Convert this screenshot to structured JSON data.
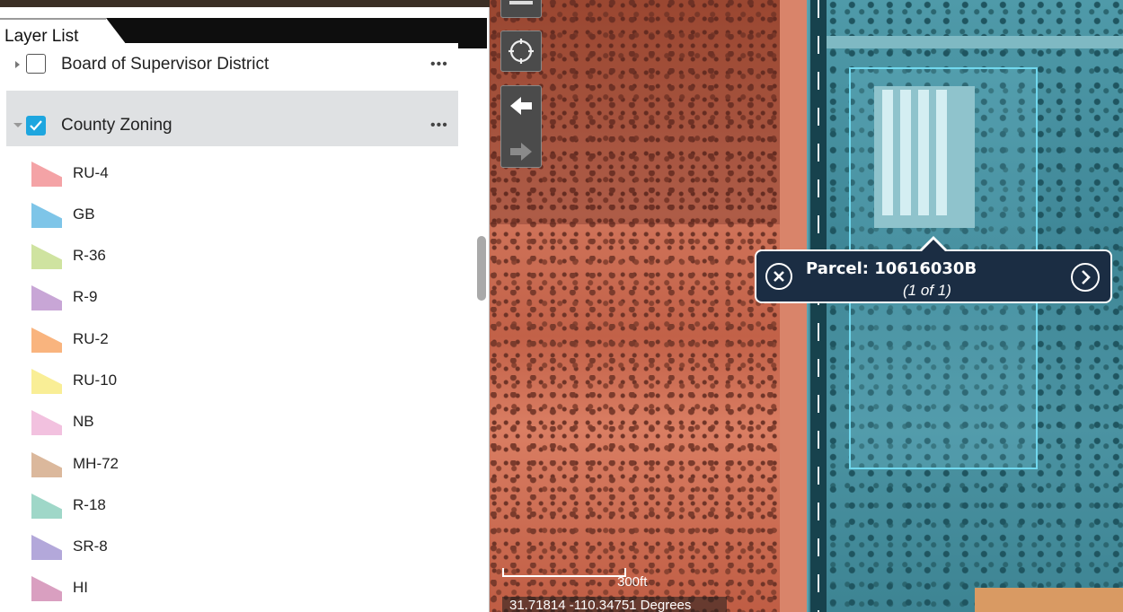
{
  "layer_list": {
    "tab_label": "Layer List",
    "layers": [
      {
        "label": "Board of Supervisor District",
        "checked": false,
        "expanded": false,
        "more": "•••"
      },
      {
        "label": "County Zoning",
        "checked": true,
        "expanded": true,
        "more": "•••"
      }
    ],
    "legend": [
      {
        "label": "RU-4",
        "color": "#f4a3a6"
      },
      {
        "label": "GB",
        "color": "#7ec5e8"
      },
      {
        "label": "R-36",
        "color": "#cfe3a0"
      },
      {
        "label": "R-9",
        "color": "#c8a6d6"
      },
      {
        "label": "RU-2",
        "color": "#f9b47e"
      },
      {
        "label": "RU-10",
        "color": "#f9ee96"
      },
      {
        "label": "NB",
        "color": "#f2c1df"
      },
      {
        "label": "MH-72",
        "color": "#dbb89c"
      },
      {
        "label": "R-18",
        "color": "#9fd7c8"
      },
      {
        "label": "SR-8",
        "color": "#b3a8da"
      },
      {
        "label": "HI",
        "color": "#d99fc0"
      }
    ]
  },
  "map": {
    "popup": {
      "title": "Parcel: 10616030B",
      "subtitle": "(1 of 1)"
    },
    "scale_label": "300ft",
    "coordinates": "31.71814 -110.34751 Degrees",
    "accent_color": "#1ea6df",
    "parcel_outline_color": "#71d8ee",
    "popup_color": "#1b2d43"
  }
}
